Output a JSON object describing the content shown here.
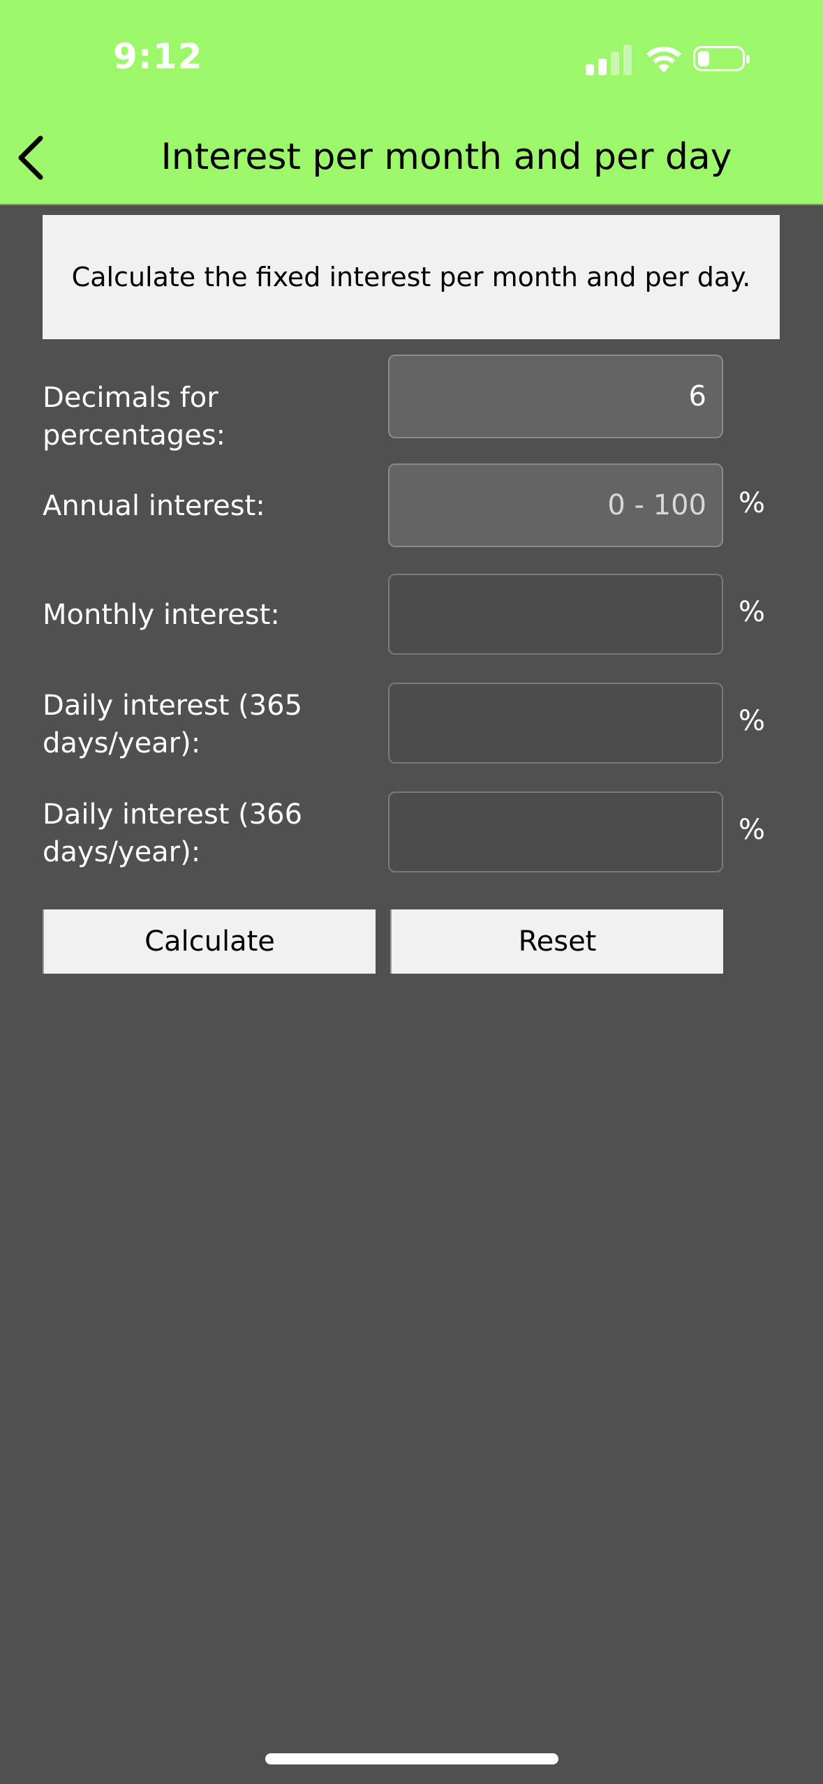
{
  "status_bar": {
    "time": "9:12",
    "signal_bars_active": 2,
    "signal_bars_total": 4,
    "battery_level": 0.2
  },
  "nav": {
    "title": "Interest per month and per day",
    "back_icon": "chevron-left-icon"
  },
  "description": "Calculate the fixed interest per month and per day.",
  "form": {
    "decimals": {
      "label": "Decimals for percentages:",
      "value": "6"
    },
    "annual": {
      "label": "Annual interest:",
      "placeholder": "0 - 100",
      "unit": "%"
    },
    "monthly": {
      "label": "Monthly interest:",
      "value": "",
      "unit": "%"
    },
    "daily365": {
      "label": "Daily interest (365 days/year):",
      "value": "",
      "unit": "%"
    },
    "daily366": {
      "label": "Daily interest (366 days/year):",
      "value": "",
      "unit": "%"
    }
  },
  "buttons": {
    "calculate": "Calculate",
    "reset": "Reset"
  },
  "colors": {
    "header_bg": "#9df76b",
    "page_bg": "#505050",
    "panel_bg": "#f1f1f1",
    "filled_field_bg": "#646464"
  }
}
